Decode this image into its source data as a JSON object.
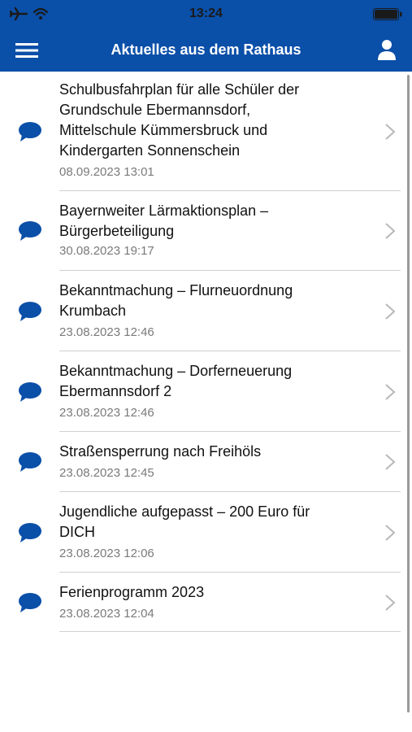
{
  "status_bar": {
    "time": "13:24"
  },
  "nav": {
    "title": "Aktuelles aus dem Rathaus"
  },
  "colors": {
    "header": "#0a4fa8",
    "icon": "#0a4fa8",
    "separator": "#d0d0d0",
    "date": "#7a7a7a"
  },
  "news": [
    {
      "title_lines": [
        "Schulbusfahrplan für alle Schüler der",
        "Grundschule Ebermannsdorf,",
        "Mittelschule Kümmersbruck und",
        "Kindergarten Sonnenschein"
      ],
      "date": "08.09.2023 13:01"
    },
    {
      "title_lines": [
        "Bayernweiter Lärmaktionsplan –",
        "Bürgerbeteiligung"
      ],
      "date": "30.08.2023 19:17"
    },
    {
      "title_lines": [
        "Bekanntmachung – Flurneuordnung",
        "Krumbach"
      ],
      "date": "23.08.2023 12:46"
    },
    {
      "title_lines": [
        "Bekanntmachung – Dorferneuerung",
        "Ebermannsdorf 2"
      ],
      "date": "23.08.2023 12:46"
    },
    {
      "title_lines": [
        "Straßensperrung nach Freihöls"
      ],
      "date": "23.08.2023 12:45"
    },
    {
      "title_lines": [
        "Jugendliche aufgepasst – 200 Euro für",
        "DICH"
      ],
      "date": "23.08.2023 12:06"
    },
    {
      "title_lines": [
        "Ferienprogramm 2023"
      ],
      "date": "23.08.2023 12:04"
    }
  ]
}
